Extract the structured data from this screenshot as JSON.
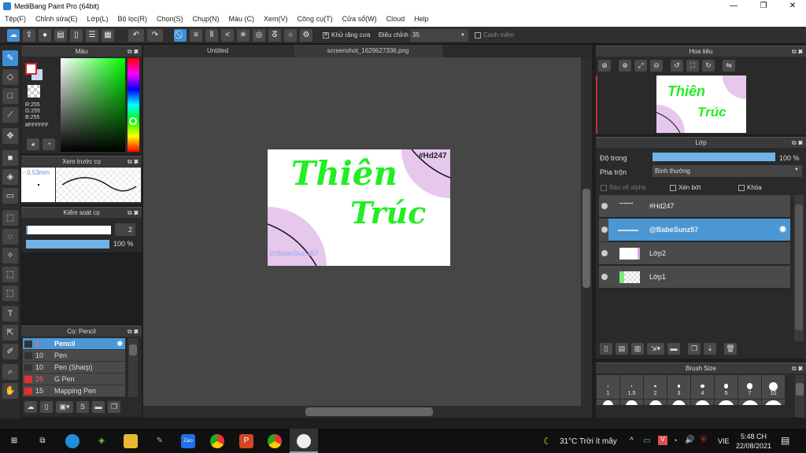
{
  "window": {
    "title": "MediBang Paint Pro (64bit)",
    "minimize": "—",
    "maximize": "❐",
    "close": "✕"
  },
  "menu": [
    "Tệp(F)",
    "Chỉnh sửa(E)",
    "Lớp(L)",
    "Bộ lọc(R)",
    "Chọn(S)",
    "Chụp(N)",
    "Màu (C)",
    "Xem(V)",
    "Công cụ(T)",
    "Cửa sổ(W)",
    "Cloud",
    "Help"
  ],
  "toolbar": {
    "antialias_label": "Khử răng cưa",
    "antialias_checked": true,
    "adjust_label": "Điều chỉnh",
    "adjust_value": "35",
    "smooth_label": "Canh mềm",
    "smooth_checked": false
  },
  "color_panel": {
    "title": "Màu",
    "r": "R:255",
    "g": "G:255",
    "b": "B:255",
    "hex": "#FFFFFF"
  },
  "brush_preview": {
    "title": "Xem trước cọ",
    "size": "0.53mm"
  },
  "brush_control": {
    "title": "Kiểm soát cọ",
    "size_value": "2",
    "opacity_value": "100 %",
    "opacity_percent": 100
  },
  "brush_panel": {
    "title": "Cọ: Pencil",
    "items": [
      {
        "size": "2",
        "name": "Pencil",
        "color": "#333333",
        "selected": true
      },
      {
        "size": "10",
        "name": "Pen",
        "color": "#333333"
      },
      {
        "size": "10",
        "name": "Pen (Sharp)",
        "color": "#333333"
      },
      {
        "size": "25",
        "name": "G Pen",
        "color": "#e53030"
      },
      {
        "size": "15",
        "name": "Mapping Pen",
        "color": "#e53030"
      }
    ]
  },
  "tabs": [
    {
      "label": "Untitled"
    },
    {
      "label": "screenshot_1629627336.png",
      "active": true
    }
  ],
  "artwork": {
    "line1": "Thiên",
    "line2": "Trúc",
    "tag": "#Hd247",
    "watermark": "@BabeSunz57"
  },
  "navigator": {
    "title": "Hoa tiêu"
  },
  "layer_panel": {
    "title": "Lớp",
    "opacity_label": "Độ trong",
    "opacity_value": "100 %",
    "opacity_percent": 100,
    "blend_label": "Pha trộn",
    "blend_value": "Bình thường",
    "protect_alpha": "Bảo vệ alpha",
    "clipping": "Xén bớt",
    "lock": "Khóa",
    "layers": [
      {
        "name": "#Hd247"
      },
      {
        "name": "@BabeSunz57",
        "selected": true
      },
      {
        "name": "Lớp2"
      },
      {
        "name": "Lớp1"
      }
    ]
  },
  "brush_size": {
    "title": "Brush Size",
    "sizes": [
      "1",
      "1.5",
      "2",
      "3",
      "4",
      "5",
      "7",
      "10"
    ]
  },
  "taskbar": {
    "weather": "31°C  Trời ít mây",
    "lang": "VIE",
    "time": "5:48 CH",
    "date": "22/08/2021"
  }
}
